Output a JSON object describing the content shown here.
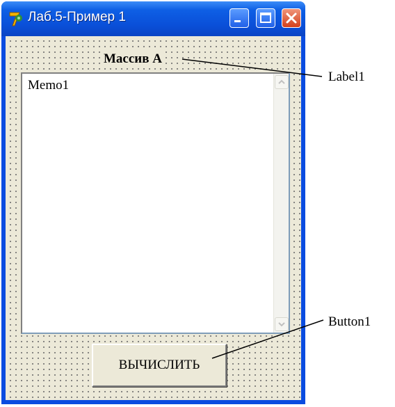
{
  "window": {
    "title": "Лаб.5-Пример 1",
    "title_icon": "delphi-app-icon",
    "controls": [
      "minimize-icon",
      "maximize-icon",
      "close-icon"
    ],
    "colors": {
      "titlebar": "#0a4fd8",
      "client": "#ece9d8",
      "close": "#d2401c"
    }
  },
  "form": {
    "label1_text": "Массив А",
    "memo1_text": "Memo1",
    "button1_text": "ВЫЧИСЛИТЬ"
  },
  "callouts": {
    "label1": "Label1",
    "button1": "Button1"
  }
}
